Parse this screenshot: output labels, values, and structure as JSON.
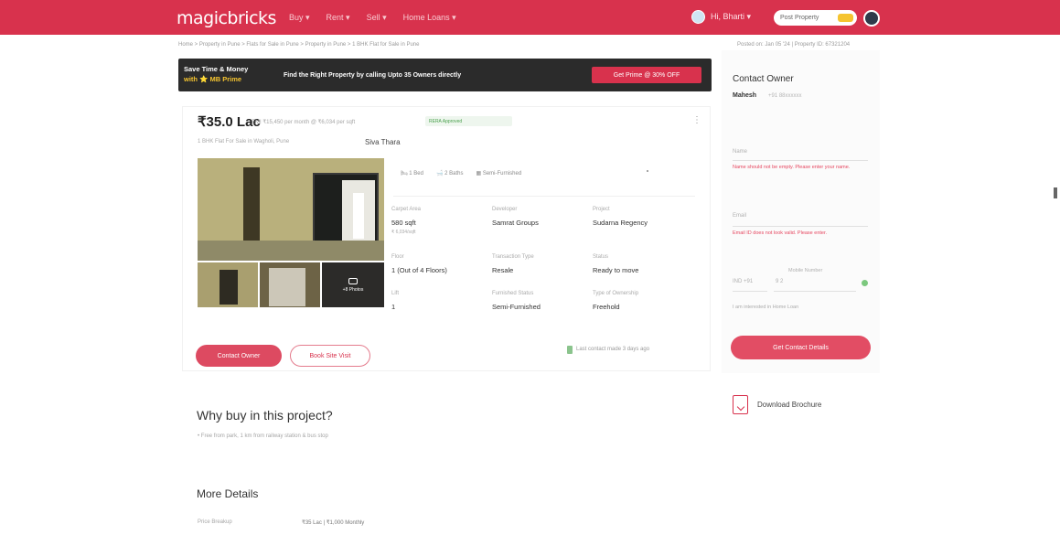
{
  "header": {
    "logo": "magicbricks",
    "nav": [
      "Buy ▾",
      "Rent ▾",
      "Sell ▾",
      "Home Loans ▾"
    ],
    "user_name": "Hi, Bharti ▾",
    "post_property": "Post Property",
    "post_property_tag": "FREE"
  },
  "breadcrumb": "Home > Property in Pune > Flats for Sale in Pune > Property in Pune > 1 BHK Flat for Sale in Pune",
  "posted_on": "Posted on: Jan 05 '24 | Property ID: 67321204",
  "banner": {
    "line1": "Save Time & Money",
    "line2": "with ⭐ MB Prime",
    "message": "Find the Right Property by calling Upto 35 Owners directly",
    "button": "Get Prime @ 30% OFF"
  },
  "property": {
    "price": "₹35.0 Lac",
    "price_per_sqft": "EMI ₹15,450 per month @ ₹6,034 per sqft",
    "rera": "RERA Approved",
    "summary": "1 BHK Flat For Sale in Wagholi, Pune",
    "project": "Siva Thara",
    "icons": [
      "1 Bed",
      "2 Baths",
      "Semi-Furnished"
    ],
    "photo_count": "+8 Photos",
    "fields": [
      {
        "label": "Carpet Area",
        "value": "580 sqft",
        "sub": "₹ 6,034/sqft"
      },
      {
        "label": "Developer",
        "value": "Samrat Groups"
      },
      {
        "label": "Project",
        "value": "Sudarna Regency"
      },
      {
        "label": "Floor",
        "value": "1 (Out of 4 Floors)"
      },
      {
        "label": "Transaction Type",
        "value": "Resale"
      },
      {
        "label": "Status",
        "value": "Ready to move"
      },
      {
        "label": "Lift",
        "value": "1"
      },
      {
        "label": "Furnished Status",
        "value": "Semi-Furnished"
      },
      {
        "label": "Type of Ownership",
        "value": "Freehold"
      }
    ],
    "contact_button": "Contact Owner",
    "visit_button": "Book Site Visit",
    "last_contact": "Last contact made 3 days ago"
  },
  "contact_panel": {
    "title": "Contact Owner",
    "owner_name": "Mahesh",
    "owner_phone": "+91 88xxxxxx",
    "name_placeholder": "Name",
    "name_error": "Name should not be empty. Please enter your name.",
    "email_placeholder": "Email",
    "email_error": "Email ID does not look valid. Please enter.",
    "country_code": "IND +91",
    "phone_label": "Mobile Number",
    "phone_value": "9 2",
    "interest": "I am interested in Home Loan",
    "submit": "Get Contact Details",
    "brochure": "Download Brochure"
  },
  "why_buy": {
    "title": "Why buy in this project?",
    "bullet": "Free from park, 1 km from railway station & bus stop",
    "footer": ""
  },
  "more_details": {
    "title": "More Details",
    "price_label": "Price Breakup",
    "price_value": "₹35 Lac | ₹1,000 Monthly"
  },
  "colors": {
    "brand": "#d8324d",
    "banner_bg": "#2b2b2b",
    "prime_gold": "#f5c430"
  }
}
